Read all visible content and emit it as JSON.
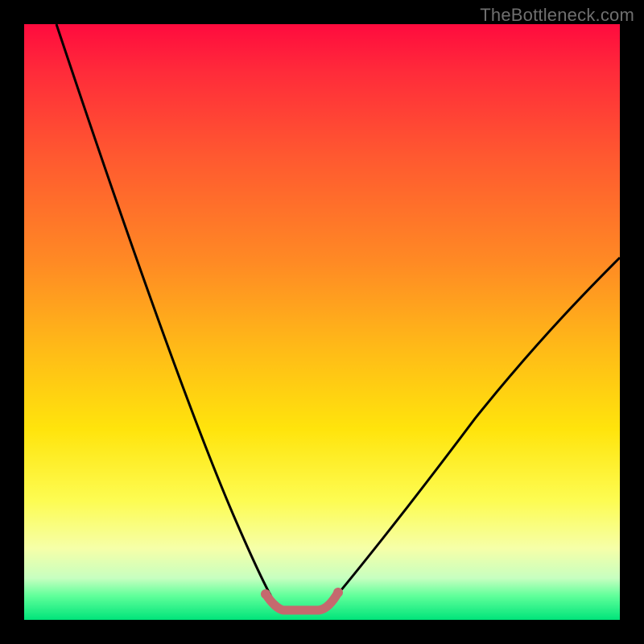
{
  "watermark": {
    "text": "TheBottleneck.com"
  },
  "colors": {
    "black": "#000000",
    "curve": "#000000",
    "flat_segment": "#c5696e",
    "grad_top": "#ff0b3e",
    "grad_bottom": "#00e47a"
  },
  "chart_data": {
    "type": "line",
    "title": "",
    "xlabel": "",
    "ylabel": "",
    "xlim": [
      0,
      100
    ],
    "ylim": [
      0,
      100
    ],
    "note": "No axes/ticks/legend shown. Vertical gradient encodes value: top≈100 (red) → bottom≈0 (green). Black curve falls steeply from left, has flat minimum highlighted in salmon, then rises more gently to the right.",
    "series": [
      {
        "name": "bottleneck-curve",
        "x": [
          5,
          10,
          15,
          20,
          25,
          30,
          35,
          38,
          40,
          43,
          47,
          50,
          55,
          60,
          70,
          80,
          90,
          100
        ],
        "values": [
          100,
          90,
          78,
          66,
          53,
          40,
          27,
          15,
          5,
          1,
          0,
          1,
          7,
          14,
          26,
          37,
          46,
          53
        ]
      }
    ],
    "highlight_flat_segment": {
      "x_start": 40,
      "x_end": 50,
      "y": 1
    }
  }
}
